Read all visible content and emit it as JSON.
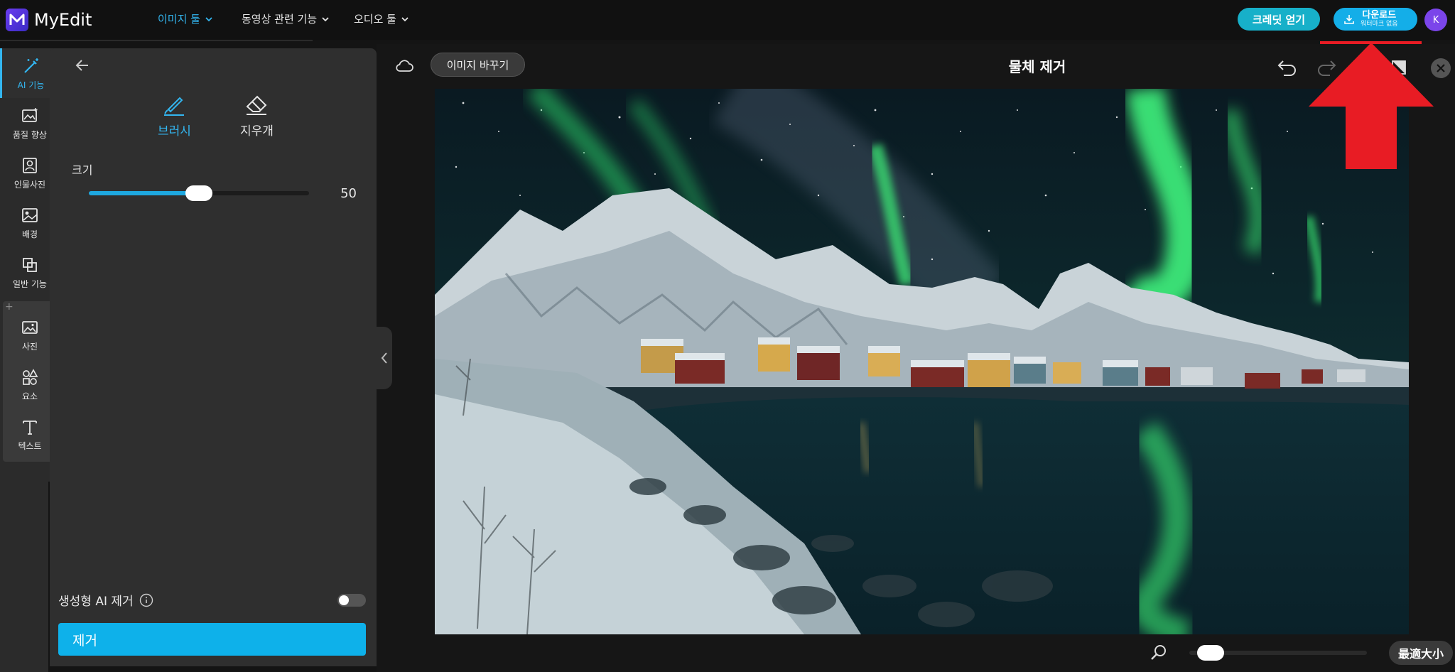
{
  "app": {
    "name": "MyEdit",
    "avatar_letter": "K"
  },
  "nav": [
    {
      "label": "이미지 툴",
      "active": true
    },
    {
      "label": "동영상 관련 기능",
      "active": false
    },
    {
      "label": "오디오 툴",
      "active": false
    }
  ],
  "header": {
    "credit_label": "크레딧 얻기",
    "download_label": "다운로드",
    "download_sub": "워터마크 없음"
  },
  "rail": [
    {
      "label": "AI 기능",
      "icon": "magic-wand-icon",
      "active": true
    },
    {
      "label": "품질 향상",
      "icon": "enhance-image-icon"
    },
    {
      "label": "인물사진",
      "icon": "portrait-icon"
    },
    {
      "label": "배경",
      "icon": "background-icon"
    },
    {
      "label": "일반 기능",
      "icon": "crop-icon"
    },
    {
      "label": "사진",
      "icon": "photo-icon"
    },
    {
      "label": "요소",
      "icon": "shapes-icon"
    },
    {
      "label": "텍스트",
      "icon": "text-icon"
    }
  ],
  "panel": {
    "tools": [
      {
        "label": "브러시",
        "icon": "brush-icon",
        "active": true
      },
      {
        "label": "지우개",
        "icon": "eraser-icon",
        "active": false
      }
    ],
    "size_label": "크기",
    "size_value": "50",
    "size_fraction": 0.5,
    "generative_label": "생성형 AI 제거",
    "generative_enabled": false,
    "remove_label": "제거"
  },
  "canvas": {
    "replace_label": "이미지 바꾸기",
    "title": "물체 제거",
    "zoom_fraction": 0.05,
    "fit_label": "最適大小"
  },
  "colors": {
    "accent": "#33b6f0",
    "remove_button": "#0eb1ea",
    "highlight_arrow": "#e81c24"
  }
}
